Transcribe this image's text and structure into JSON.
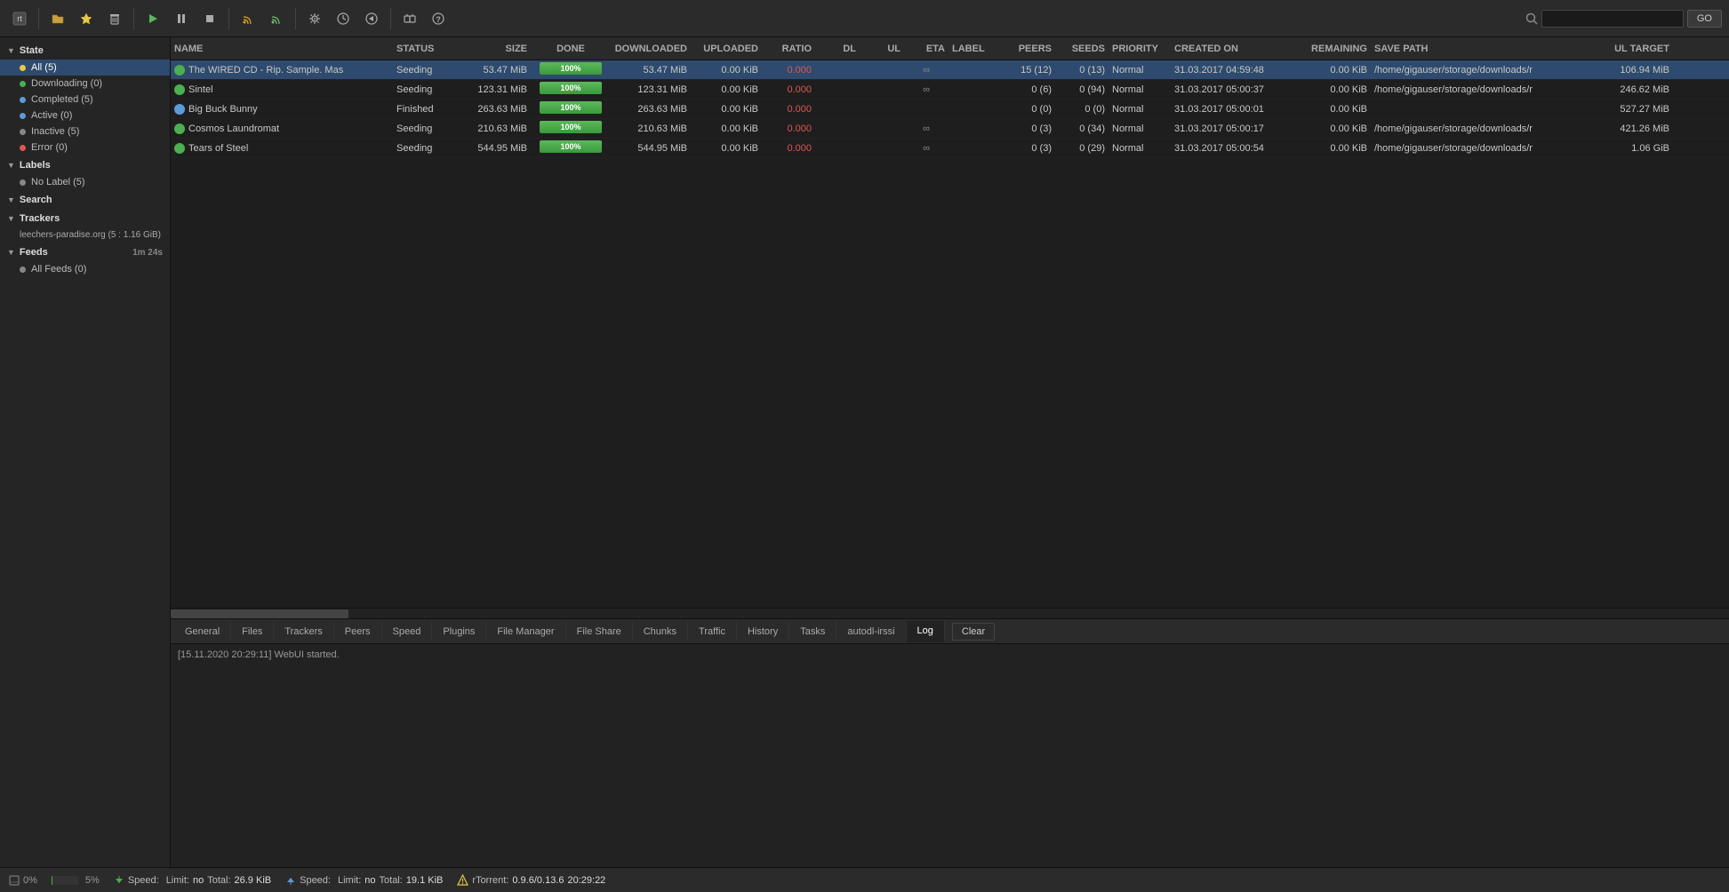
{
  "toolbar": {
    "buttons": [
      {
        "name": "logo-button",
        "icon": "⬛"
      },
      {
        "name": "open-button",
        "icon": "📂"
      },
      {
        "name": "bookmark-button",
        "icon": "⭐"
      },
      {
        "name": "delete-button",
        "icon": "🗑"
      },
      {
        "name": "play-button",
        "icon": "▶"
      },
      {
        "name": "pause-button",
        "icon": "⏸"
      },
      {
        "name": "stop-button",
        "icon": "⏹"
      },
      {
        "name": "rss1-button",
        "icon": "📡"
      },
      {
        "name": "rss2-button",
        "icon": "📡"
      },
      {
        "name": "settings-button",
        "icon": "⚙"
      },
      {
        "name": "clock-button",
        "icon": "🕐"
      },
      {
        "name": "nav-button",
        "icon": "⬅"
      },
      {
        "name": "plugin-button",
        "icon": "🔌"
      },
      {
        "name": "help-button",
        "icon": "❓"
      }
    ],
    "search_placeholder": "",
    "go_label": "GO"
  },
  "sidebar": {
    "state_section": "State",
    "items_state": [
      {
        "label": "All (5)",
        "count": 5,
        "dot": "yellow",
        "active": true
      },
      {
        "label": "Downloading (0)",
        "count": 0,
        "dot": "green"
      },
      {
        "label": "Completed (5)",
        "count": 5,
        "dot": "blue"
      },
      {
        "label": "Active (0)",
        "count": 0,
        "dot": "blue"
      },
      {
        "label": "Inactive (5)",
        "count": 5,
        "dot": "gray"
      },
      {
        "label": "Error (0)",
        "count": 0,
        "dot": "red"
      }
    ],
    "labels_section": "Labels",
    "items_labels": [
      {
        "label": "No Label (5)",
        "count": 5
      }
    ],
    "search_section": "Search",
    "trackers_section": "Trackers",
    "items_trackers": [
      {
        "label": "leechers-paradise.org (5 : 1.16 GiB)"
      }
    ],
    "feeds_section": "Feeds",
    "feeds_timer": "1m 24s",
    "items_feeds": [
      {
        "label": "All Feeds (0)",
        "count": 0
      }
    ]
  },
  "table": {
    "columns": {
      "name": "NAME",
      "status": "STATUS",
      "size": "SIZE",
      "done": "DONE",
      "downloaded": "DOWNLOADED",
      "uploaded": "UPLOADED",
      "ratio": "RATIO",
      "dl": "DL",
      "ul": "UL",
      "eta": "ETA",
      "label": "LABEL",
      "peers": "PEERS",
      "seeds": "SEEDS",
      "priority": "PRIORITY",
      "created_on": "CREATED ON",
      "remaining": "REMAINING",
      "save_path": "SAVE PATH",
      "ul_target": "UL TARGET"
    },
    "rows": [
      {
        "name": "The WIRED CD - Rip. Sample. Mas",
        "status": "Seeding",
        "size": "53.47 MiB",
        "done": "100%",
        "downloaded": "53.47 MiB",
        "uploaded": "0.00 KiB",
        "ratio": "0.000",
        "dl": "",
        "ul": "",
        "eta": "∞",
        "label": "",
        "peers": "15 (12)",
        "seeds": "0 (13)",
        "priority": "Normal",
        "created_on": "31.03.2017 04:59:48",
        "remaining": "0.00 KiB",
        "save_path": "/home/gigauser/storage/downloads/r",
        "ul_target": "106.94 MiB",
        "type": "seeding"
      },
      {
        "name": "Sintel",
        "status": "Seeding",
        "size": "123.31 MiB",
        "done": "100%",
        "downloaded": "123.31 MiB",
        "uploaded": "0.00 KiB",
        "ratio": "0.000",
        "dl": "",
        "ul": "",
        "eta": "∞",
        "label": "",
        "peers": "0 (6)",
        "seeds": "0 (94)",
        "priority": "Normal",
        "created_on": "31.03.2017 05:00:37",
        "remaining": "0.00 KiB",
        "save_path": "/home/gigauser/storage/downloads/r",
        "ul_target": "246.62 MiB",
        "type": "seeding"
      },
      {
        "name": "Big Buck Bunny",
        "status": "Finished",
        "size": "263.63 MiB",
        "done": "100%",
        "downloaded": "263.63 MiB",
        "uploaded": "0.00 KiB",
        "ratio": "0.000",
        "dl": "",
        "ul": "",
        "eta": "",
        "label": "",
        "peers": "0 (0)",
        "seeds": "0 (0)",
        "priority": "Normal",
        "created_on": "31.03.2017 05:00:01",
        "remaining": "0.00 KiB",
        "save_path": "",
        "ul_target": "527.27 MiB",
        "type": "finished"
      },
      {
        "name": "Cosmos Laundromat",
        "status": "Seeding",
        "size": "210.63 MiB",
        "done": "100%",
        "downloaded": "210.63 MiB",
        "uploaded": "0.00 KiB",
        "ratio": "0.000",
        "dl": "",
        "ul": "",
        "eta": "∞",
        "label": "",
        "peers": "0 (3)",
        "seeds": "0 (34)",
        "priority": "Normal",
        "created_on": "31.03.2017 05:00:17",
        "remaining": "0.00 KiB",
        "save_path": "/home/gigauser/storage/downloads/r",
        "ul_target": "421.26 MiB",
        "type": "seeding"
      },
      {
        "name": "Tears of Steel",
        "status": "Seeding",
        "size": "544.95 MiB",
        "done": "100%",
        "downloaded": "544.95 MiB",
        "uploaded": "0.00 KiB",
        "ratio": "0.000",
        "dl": "",
        "ul": "",
        "eta": "∞",
        "label": "",
        "peers": "0 (3)",
        "seeds": "0 (29)",
        "priority": "Normal",
        "created_on": "31.03.2017 05:00:54",
        "remaining": "0.00 KiB",
        "save_path": "/home/gigauser/storage/downloads/r",
        "ul_target": "1.06 GiB",
        "type": "seeding"
      }
    ]
  },
  "bottom_tabs": {
    "tabs": [
      {
        "label": "General",
        "name": "tab-general"
      },
      {
        "label": "Files",
        "name": "tab-files"
      },
      {
        "label": "Trackers",
        "name": "tab-trackers"
      },
      {
        "label": "Peers",
        "name": "tab-peers"
      },
      {
        "label": "Speed",
        "name": "tab-speed"
      },
      {
        "label": "Plugins",
        "name": "tab-plugins"
      },
      {
        "label": "File Manager",
        "name": "tab-filemanager"
      },
      {
        "label": "File Share",
        "name": "tab-fileshare"
      },
      {
        "label": "Chunks",
        "name": "tab-chunks"
      },
      {
        "label": "Traffic",
        "name": "tab-traffic"
      },
      {
        "label": "History",
        "name": "tab-history"
      },
      {
        "label": "Tasks",
        "name": "tab-tasks"
      },
      {
        "label": "autodl-irssi",
        "name": "tab-autodl"
      },
      {
        "label": "Log",
        "name": "tab-log",
        "active": true
      }
    ],
    "clear_label": "Clear",
    "log_content": "[15.11.2020 20:29:11] WebUI started."
  },
  "statusbar": {
    "percent": "0%",
    "dl_speed_label": "Speed:",
    "dl_speed_value": "",
    "dl_limit_label": "Limit:",
    "dl_limit_value": "no",
    "dl_total_label": "Total:",
    "dl_total_value": "26.9 KiB",
    "ul_speed_label": "Speed:",
    "ul_speed_value": "",
    "ul_limit_label": "Limit:",
    "ul_limit_value": "no",
    "ul_total_label": "Total:",
    "ul_total_value": "19.1 KiB",
    "rtorrent_label": "rTorrent:",
    "rtorrent_value": "0.9.6/0.13.6",
    "time_value": "20:29:22"
  }
}
